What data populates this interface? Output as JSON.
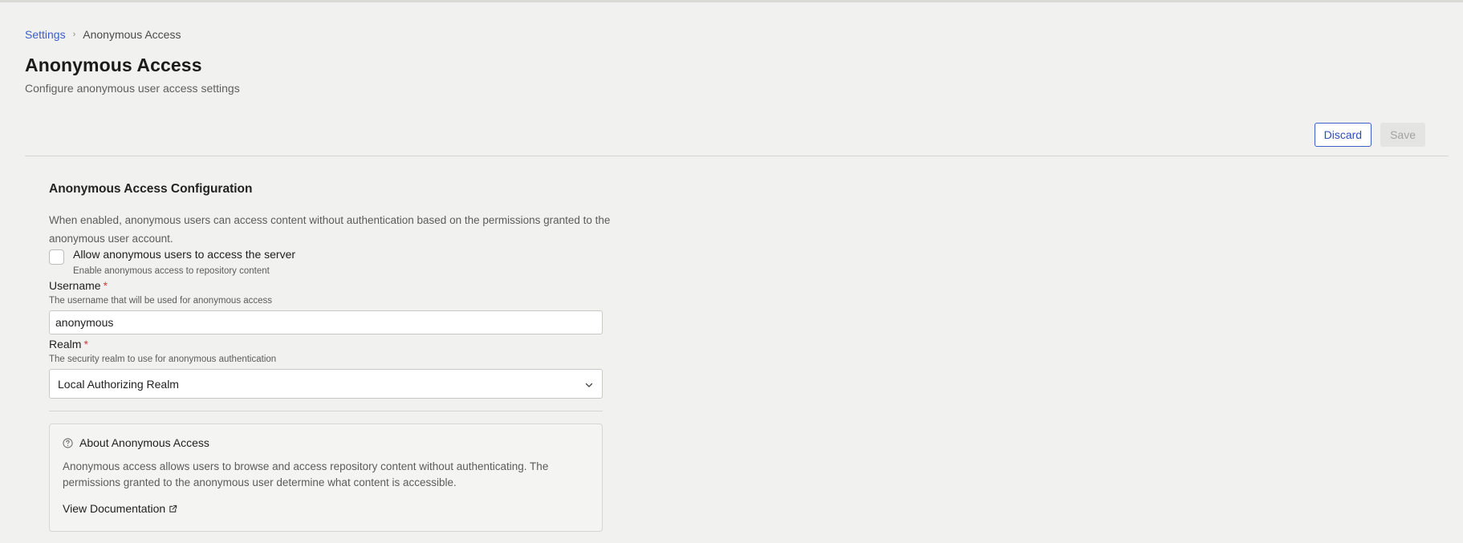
{
  "breadcrumb": {
    "parent": "Settings",
    "separator": "›",
    "current": "Anonymous Access"
  },
  "header": {
    "title": "Anonymous Access",
    "subtitle": "Configure anonymous user access settings"
  },
  "actions": {
    "discard_label": "Discard",
    "save_label": "Save"
  },
  "section": {
    "title": "Anonymous Access Configuration",
    "description": "When enabled, anonymous users can access content without authentication based on the permissions granted to the anonymous user account."
  },
  "allow_anonymous": {
    "label": "Allow anonymous users to access the server",
    "help": "Enable anonymous access to repository content",
    "checked": false
  },
  "username": {
    "label": "Username",
    "required_mark": "*",
    "help": "The username that will be used for anonymous access",
    "value": "anonymous"
  },
  "realm": {
    "label": "Realm",
    "required_mark": "*",
    "help": "The security realm to use for anonymous authentication",
    "selected": "Local Authorizing Realm"
  },
  "info": {
    "icon": "help-circle-icon",
    "title": "About Anonymous Access",
    "text": "Anonymous access allows users to browse and access repository content without authenticating. The permissions granted to the anonymous user determine what content is accessible.",
    "link_label": "View Documentation",
    "link_icon": "external-link-icon"
  },
  "colors": {
    "accent": "#3b5fc9",
    "required": "#d23b3b",
    "background": "#f1f1ef"
  }
}
